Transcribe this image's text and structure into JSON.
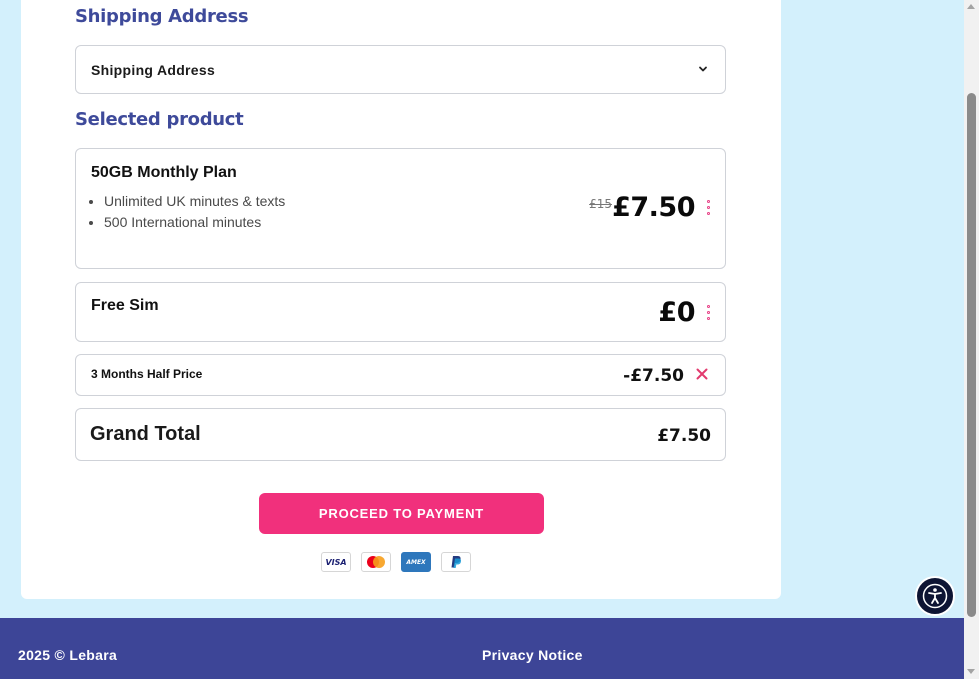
{
  "shipping": {
    "heading": "Shipping Address",
    "select_value": "Shipping Address",
    "chevron_icon": "chevron-down-icon"
  },
  "product": {
    "heading": "Selected product",
    "plan": {
      "name": "50GB Monthly Plan",
      "features": [
        "Unlimited UK minutes & texts",
        "500 International minutes"
      ],
      "old_price": "£15",
      "price": "£7.50",
      "menu_icon": "more-vertical-icon"
    },
    "sim": {
      "name": "Free Sim",
      "price": "£0",
      "menu_icon": "more-vertical-icon"
    },
    "promo": {
      "name": "3 Months Half Price",
      "price": "-£7.50",
      "remove_icon": "close-icon"
    },
    "total": {
      "label": "Grand Total",
      "price": "£7.50"
    }
  },
  "cta": {
    "label": "PROCEED TO PAYMENT"
  },
  "payment_methods": [
    {
      "name": "visa",
      "label": "VISA"
    },
    {
      "name": "mastercard",
      "label": ""
    },
    {
      "name": "amex",
      "label": "AMEX"
    },
    {
      "name": "paypal",
      "label": ""
    }
  ],
  "footer": {
    "copyright": "2025 © Lebara",
    "privacy_link": "Privacy Notice"
  },
  "accessibility": {
    "icon": "accessibility-icon"
  },
  "colors": {
    "page_bg": "#d3f0fc",
    "heading": "#3e4a9a",
    "accent": "#f1307c",
    "footer_bg": "#3d4597",
    "remove": "#e23a6e"
  }
}
